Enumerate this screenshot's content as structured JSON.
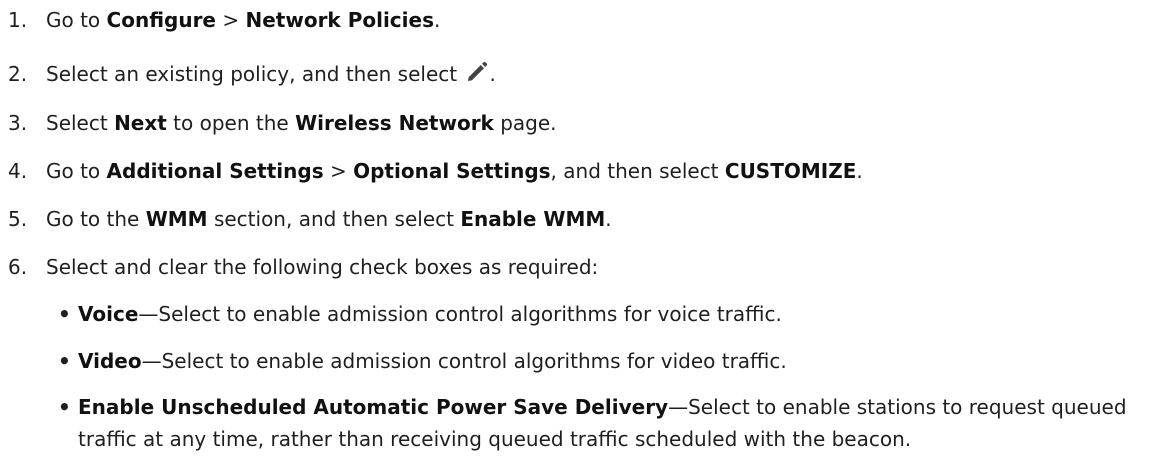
{
  "steps": [
    {
      "num": "1.",
      "t0": "Go to ",
      "b0": "Configure",
      "t1": " > ",
      "b1": "Network Policies",
      "t2": "."
    },
    {
      "num": "2.",
      "t0": "Select an existing policy, and then select ",
      "icon": "pencil-icon",
      "t1": "."
    },
    {
      "num": "3.",
      "t0": "Select ",
      "b0": "Next",
      "t1": " to open the ",
      "b1": "Wireless Network",
      "t2": " page."
    },
    {
      "num": "4.",
      "t0": "Go to ",
      "b0": "Additional Settings",
      "t1": " > ",
      "b1": "Optional Settings",
      "t2": ", and then select ",
      "b2": "CUSTOMIZE",
      "t3": "."
    },
    {
      "num": "5.",
      "t0": "Go to the ",
      "b0": "WMM",
      "t1": " section, and then select ",
      "b1": "Enable WMM",
      "t2": "."
    },
    {
      "num": "6.",
      "t0": "Select and clear the following check boxes as required:"
    }
  ],
  "bullets": [
    {
      "dot": "•",
      "bold": "Voice",
      "text": "—Select to enable admission control algorithms for voice traffic."
    },
    {
      "dot": "•",
      "bold": "Video",
      "text": "—Select to enable admission control algorithms for video traffic."
    },
    {
      "dot": "•",
      "bold": "Enable Unscheduled Automatic Power Save Delivery",
      "text": "—Select to enable stations to request queued traffic at any time, rather than receiving queued traffic scheduled with the beacon."
    }
  ],
  "colors": {
    "text": "#1f1f1f",
    "icon": "#444444"
  }
}
